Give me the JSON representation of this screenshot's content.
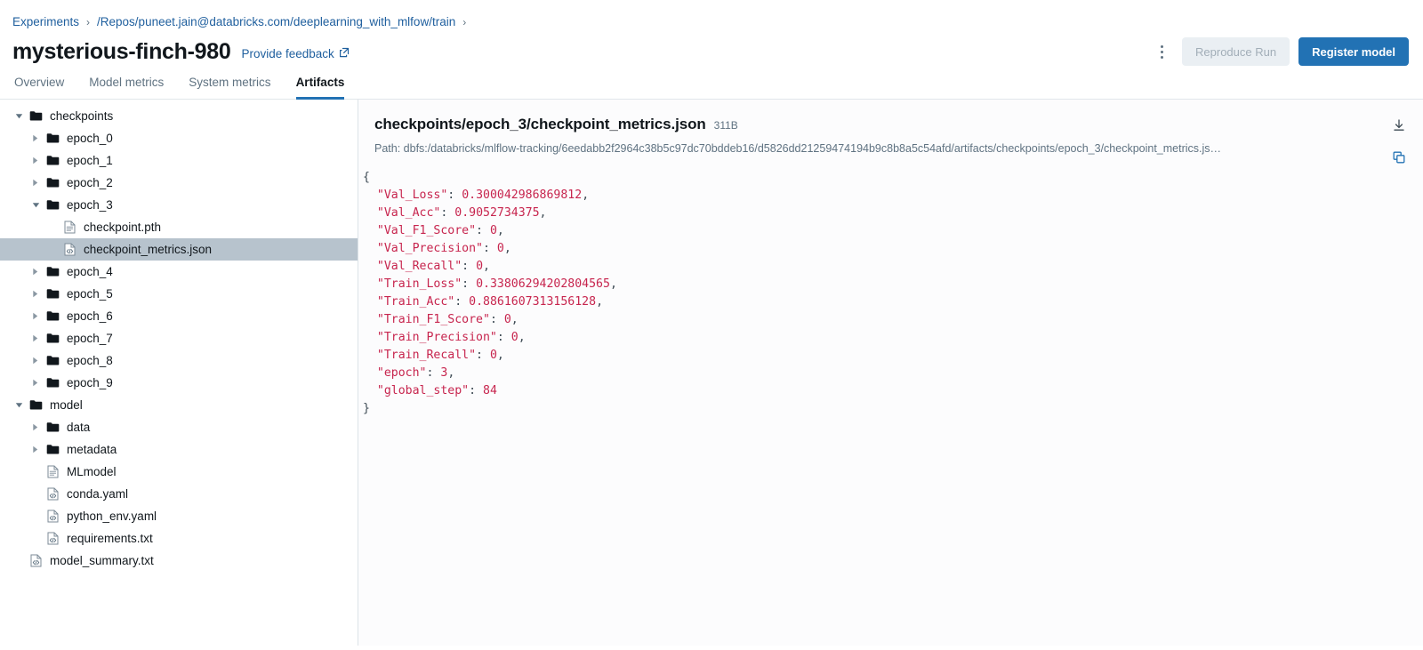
{
  "breadcrumb": {
    "items": [
      {
        "label": "Experiments"
      },
      {
        "label": "/Repos/puneet.jain@databricks.com/deeplearning_with_mlfow/train"
      }
    ],
    "separator": "›"
  },
  "header": {
    "title": "mysterious-finch-980",
    "feedback_label": "Provide feedback",
    "feedback_icon": "external-link-icon",
    "kebab_icon": "more-vertical-icon",
    "reproduce_run_label": "Reproduce Run",
    "register_model_label": "Register model",
    "primary_color": "#2272b4",
    "link_color": "#1f5f9e"
  },
  "tabs": [
    {
      "label": "Overview",
      "active": false
    },
    {
      "label": "Model metrics",
      "active": false
    },
    {
      "label": "System metrics",
      "active": false
    },
    {
      "label": "Artifacts",
      "active": true
    }
  ],
  "tree": [
    {
      "label": "checkpoints",
      "depth": 0,
      "type": "folder",
      "state": "expanded",
      "selected": false
    },
    {
      "label": "epoch_0",
      "depth": 1,
      "type": "folder",
      "state": "collapsed",
      "selected": false
    },
    {
      "label": "epoch_1",
      "depth": 1,
      "type": "folder",
      "state": "collapsed",
      "selected": false
    },
    {
      "label": "epoch_2",
      "depth": 1,
      "type": "folder",
      "state": "collapsed",
      "selected": false
    },
    {
      "label": "epoch_3",
      "depth": 1,
      "type": "folder",
      "state": "expanded",
      "selected": false
    },
    {
      "label": "checkpoint.pth",
      "depth": 2,
      "type": "file",
      "state": "leaf",
      "selected": false
    },
    {
      "label": "checkpoint_metrics.json",
      "depth": 2,
      "type": "code",
      "state": "leaf",
      "selected": true
    },
    {
      "label": "epoch_4",
      "depth": 1,
      "type": "folder",
      "state": "collapsed",
      "selected": false
    },
    {
      "label": "epoch_5",
      "depth": 1,
      "type": "folder",
      "state": "collapsed",
      "selected": false
    },
    {
      "label": "epoch_6",
      "depth": 1,
      "type": "folder",
      "state": "collapsed",
      "selected": false
    },
    {
      "label": "epoch_7",
      "depth": 1,
      "type": "folder",
      "state": "collapsed",
      "selected": false
    },
    {
      "label": "epoch_8",
      "depth": 1,
      "type": "folder",
      "state": "collapsed",
      "selected": false
    },
    {
      "label": "epoch_9",
      "depth": 1,
      "type": "folder",
      "state": "collapsed",
      "selected": false
    },
    {
      "label": "model",
      "depth": 0,
      "type": "folder",
      "state": "expanded",
      "selected": false
    },
    {
      "label": "data",
      "depth": 1,
      "type": "folder",
      "state": "collapsed",
      "selected": false
    },
    {
      "label": "metadata",
      "depth": 1,
      "type": "folder",
      "state": "collapsed",
      "selected": false
    },
    {
      "label": "MLmodel",
      "depth": 1,
      "type": "file",
      "state": "leaf",
      "selected": false
    },
    {
      "label": "conda.yaml",
      "depth": 1,
      "type": "code",
      "state": "leaf",
      "selected": false
    },
    {
      "label": "python_env.yaml",
      "depth": 1,
      "type": "code",
      "state": "leaf",
      "selected": false
    },
    {
      "label": "requirements.txt",
      "depth": 1,
      "type": "code",
      "state": "leaf",
      "selected": false
    },
    {
      "label": "model_summary.txt",
      "depth": 0,
      "type": "code",
      "state": "leaf",
      "selected": false
    }
  ],
  "file_viewer": {
    "name": "checkpoints/epoch_3/checkpoint_metrics.json",
    "size": "311B",
    "path": "Path: dbfs:/databricks/mlflow-tracking/6eedabb2f2964c38b5c97dc70bddeb16/d5826dd21259474194b9c8b8a5c54afd/artifacts/checkpoints/epoch_3/checkpoint_metrics.js…",
    "download_icon": "download-icon",
    "copy_icon": "copy-icon",
    "open_brace": "{",
    "close_brace": "}",
    "entries": [
      {
        "key": "\"Val_Loss\"",
        "value": "0.300042986869812",
        "comma": ","
      },
      {
        "key": "\"Val_Acc\"",
        "value": "0.9052734375",
        "comma": ","
      },
      {
        "key": "\"Val_F1_Score\"",
        "value": "0",
        "comma": ","
      },
      {
        "key": "\"Val_Precision\"",
        "value": "0",
        "comma": ","
      },
      {
        "key": "\"Val_Recall\"",
        "value": "0",
        "comma": ","
      },
      {
        "key": "\"Train_Loss\"",
        "value": "0.33806294202804565",
        "comma": ","
      },
      {
        "key": "\"Train_Acc\"",
        "value": "0.8861607313156128",
        "comma": ","
      },
      {
        "key": "\"Train_F1_Score\"",
        "value": "0",
        "comma": ","
      },
      {
        "key": "\"Train_Precision\"",
        "value": "0",
        "comma": ","
      },
      {
        "key": "\"Train_Recall\"",
        "value": "0",
        "comma": ","
      },
      {
        "key": "\"epoch\"",
        "value": "3",
        "comma": ","
      },
      {
        "key": "\"global_step\"",
        "value": "84",
        "comma": ""
      }
    ]
  }
}
